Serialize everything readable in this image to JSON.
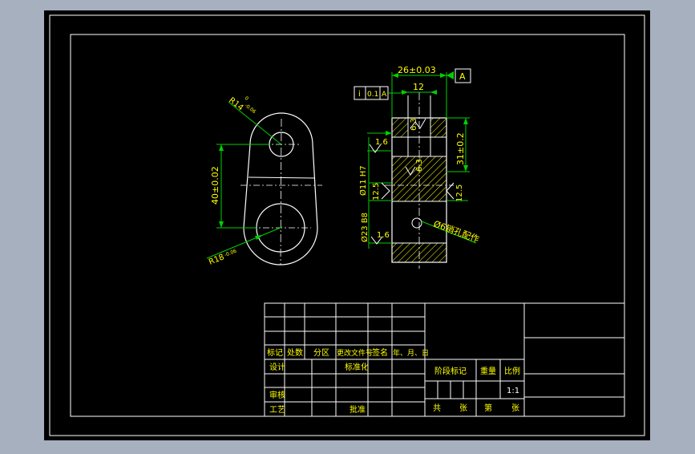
{
  "colors": {
    "background": "#a6b0bf",
    "paper": "#000000",
    "line": "#ffffff",
    "dimension": "#00d000",
    "text": "#ffff00",
    "hatch": "#ffff00"
  },
  "drawing": {
    "dim_top_width": "26±0.03",
    "datum_label": "A",
    "dim_inner_width": "12",
    "tolerance_symbol": "i",
    "tolerance_value": "0.1",
    "tolerance_datum": "A",
    "dim_hole_radius_top": "R14",
    "dim_hole_radius_top_upper": "0",
    "dim_hole_radius_top_lower": "-0.06",
    "dim_center_distance": "40±0.02",
    "dim_hole_radius_bottom": "R18",
    "dim_hole_radius_bottom_lower": "-0.06",
    "rough_top": "6.3",
    "rough_left_top": "1.6",
    "rough_mid": "6.3",
    "rough_left_mid": "12.5",
    "rough_right_mid": "12.5",
    "rough_left_bottom": "1.6",
    "dim_height": "31±0.2",
    "bore_upper": "Ø11 H7",
    "bore_lower": "Ø23 B8",
    "pin_note": "Ø6销孔配作"
  },
  "title_block": {
    "rev_headers": [
      "标记",
      "处数",
      "分区",
      "更改文件号",
      "签名",
      "年、月、日"
    ],
    "design": "设计",
    "standardize": "标准化",
    "review": "审核",
    "process": "工艺",
    "approve": "批准",
    "stage_mark": "阶段标记",
    "weight": "重量",
    "scale": "比例",
    "scale_value": "1:1",
    "total": "共",
    "sheets": "张",
    "page": "第",
    "sheet": "张"
  }
}
